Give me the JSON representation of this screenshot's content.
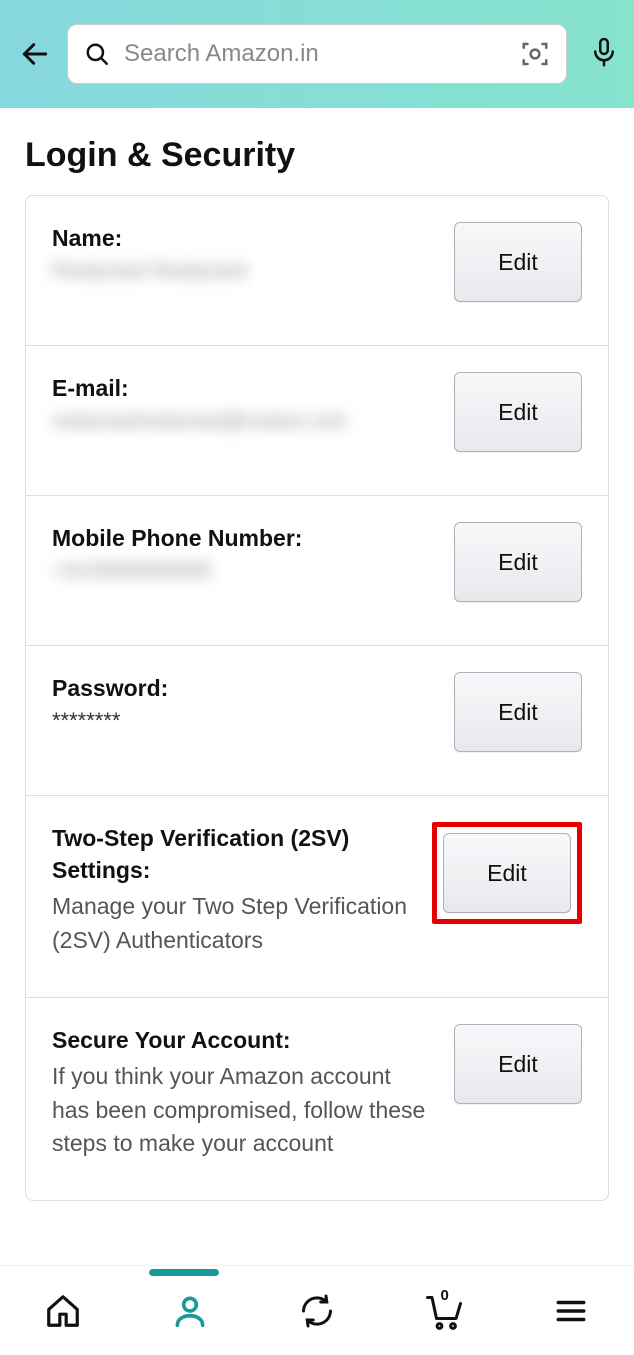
{
  "header": {
    "search_placeholder": "Search Amazon.in"
  },
  "page": {
    "title": "Login & Security"
  },
  "rows": [
    {
      "label": "Name:",
      "value": "Redacted Redacted",
      "blurred": true,
      "edit_label": "Edit"
    },
    {
      "label": "E-mail:",
      "value": "redactedredacted@redact.red",
      "blurred": true,
      "edit_label": "Edit"
    },
    {
      "label": "Mobile Phone Number:",
      "value": "+919999999999",
      "blurred": true,
      "edit_label": "Edit"
    },
    {
      "label": "Password:",
      "value": "********",
      "blurred": false,
      "edit_label": "Edit"
    },
    {
      "label": "Two-Step Verification (2SV) Settings:",
      "desc": "Manage your Two Step Verification (2SV) Authenticators",
      "highlighted": true,
      "edit_label": "Edit"
    },
    {
      "label": "Secure Your Account:",
      "desc": "If you think your Amazon account has been compromised, follow these steps to make your account",
      "edit_label": "Edit"
    }
  ],
  "nav": {
    "cart_count": "0"
  }
}
